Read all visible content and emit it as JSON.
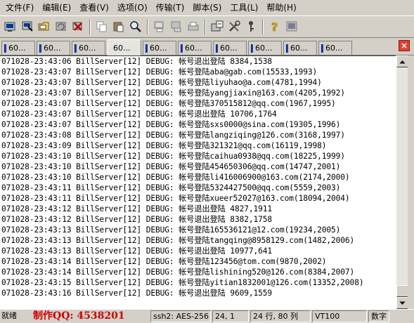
{
  "menu": [
    {
      "label": "文件(F)"
    },
    {
      "label": "编辑(E)"
    },
    {
      "label": "查看(V)"
    },
    {
      "label": "选项(O)"
    },
    {
      "label": "传输(T)"
    },
    {
      "label": "脚本(S)"
    },
    {
      "label": "工具(L)"
    },
    {
      "label": "帮助(H)"
    }
  ],
  "toolbar": [
    {
      "name": "connect-icon"
    },
    {
      "name": "quick-connect-icon"
    },
    {
      "name": "session-folder-icon"
    },
    {
      "name": "reconnect-icon"
    },
    {
      "name": "disconnect-icon"
    },
    {
      "name": "copy-icon"
    },
    {
      "name": "paste-icon"
    },
    {
      "name": "find-icon"
    },
    {
      "name": "print-icon"
    },
    {
      "name": "print-screen-icon"
    },
    {
      "name": "print-setup-icon"
    },
    {
      "name": "session-options-icon"
    },
    {
      "name": "global-options-icon"
    },
    {
      "name": "keymap-icon"
    },
    {
      "name": "help-icon"
    },
    {
      "name": "about-icon"
    }
  ],
  "tabs": [
    {
      "label": "60..."
    },
    {
      "label": "60..."
    },
    {
      "label": "60..."
    },
    {
      "label": "60..."
    },
    {
      "label": "60..."
    },
    {
      "label": "60..."
    },
    {
      "label": "60..."
    },
    {
      "label": "60..."
    },
    {
      "label": "60..."
    },
    {
      "label": "60..."
    }
  ],
  "active_tab": 3,
  "log_lines": [
    "071028-23:43:06 BillServer[12] DEBUG: 帐号退出登陆 8384,1538",
    "071028-23:43:07 BillServer[12] DEBUG: 帐号登陆aba@gab.com(15533,1993)",
    "071028-23:43:07 BillServer[12] DEBUG: 帐号登陆liyuhao@a.com(4781,1994)",
    "071028-23:43:07 BillServer[12] DEBUG: 帐号登陆yangjiaxin@163.com(4205,1992)",
    "071028-23:43:07 BillServer[12] DEBUG: 帐号登陆370515812@qq.com(1967,1995)",
    "071028-23:43:07 BillServer[12] DEBUG: 帐号退出登陆 10706,1764",
    "071028-23:43:07 BillServer[12] DEBUG: 帐号登陆sxs0000@sina.com(19305,1996)",
    "071028-23:43:08 BillServer[12] DEBUG: 帐号登陆langziqing@126.com(3168,1997)",
    "071028-23:43:09 BillServer[12] DEBUG: 帐号登陆321321@qq.com(16119,1998)",
    "071028-23:43:10 BillServer[12] DEBUG: 帐号登陆caihua0938@qq.com(18225,1999)",
    "071028-23:43:10 BillServer[12] DEBUG: 帐号登陆454650306@qq.com(14747,2001)",
    "071028-23:43:10 BillServer[12] DEBUG: 帐号登陆li416006900@163.com(2174,2000)",
    "071028-23:43:11 BillServer[12] DEBUG: 帐号登陆5324427500@qq.com(5559,2003)",
    "071028-23:43:11 BillServer[12] DEBUG: 帐号登陆xueer52027@163.com(18094,2004)",
    "071028-23:43:12 BillServer[12] DEBUG: 帐号退出登陆 4827,1911",
    "071028-23:43:12 BillServer[12] DEBUG: 帐号退出登陆 8382,1758",
    "071028-23:43:13 BillServer[12] DEBUG: 帐号登陆165536121@12.com(19234,2005)",
    "071028-23:43:13 BillServer[12] DEBUG: 帐号登陆tangqing@8958129.com(1482,2006)",
    "071028-23:43:13 BillServer[12] DEBUG: 帐号退出登陆 10977,641",
    "071028-23:43:14 BillServer[12] DEBUG: 帐号登陆123456@tom.com(9870,2002)",
    "071028-23:43:14 BillServer[12] DEBUG: 帐号登陆lishining520@126.com(8384,2007)",
    "071028-23:43:15 BillServer[12] DEBUG: 帐号登陆yitian1832001@126.com(13352,2008)",
    "071028-23:43:16 BillServer[12] DEBUG: 帐号退出登陆 9609,1559"
  ],
  "status": {
    "ready": "就绪",
    "credit": "制作QQ: 4538201",
    "protocol": "ssh2: AES-256",
    "row": "24, 1",
    "size": "24 行, 80 列",
    "terminal": "VT100",
    "num": "数字"
  }
}
